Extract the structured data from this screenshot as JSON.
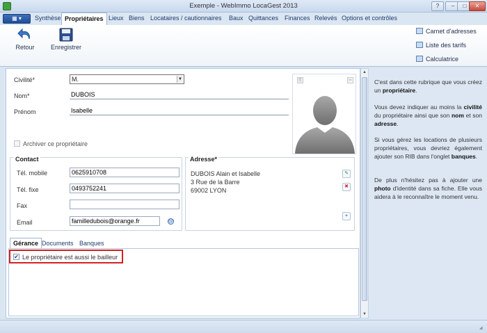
{
  "window": {
    "title": "Exemple - WebImmo LocaGest 2013",
    "help": "?",
    "minimize": "–",
    "maximize": "□",
    "close": "✕"
  },
  "file_button": "▦ ▾",
  "tabs": [
    "Synthèse",
    "Propriétaires",
    "Lieux",
    "Biens",
    "Locataires / cautionnaires",
    "Baux",
    "Quittances",
    "Finances",
    "Relevés",
    "Options et contrôles"
  ],
  "active_tab": "Propriétaires",
  "ribbon": {
    "retour": "Retour",
    "enregistrer": "Enregistrer",
    "carnet": "Carnet d'adresses",
    "tarifs": "Liste des tarifs",
    "calculatrice": "Calculatrice"
  },
  "form": {
    "civilite_label": "Civilité*",
    "civilite_value": "M.",
    "nom_label": "Nom*",
    "nom_value": "DUBOIS",
    "prenom_label": "Prénom",
    "prenom_value": "Isabelle",
    "archiver_label": "Archiver ce propriétaire",
    "contact_title": "Contact",
    "tel_mobile_label": "Tél. mobile",
    "tel_mobile_value": "0625910708",
    "tel_fixe_label": "Tél. fixe",
    "tel_fixe_value": "0493752241",
    "fax_label": "Fax",
    "fax_value": "",
    "email_label": "Email",
    "email_value": "familledubois@orange.fr",
    "adresse_title": "Adresse*",
    "adresse_lines": [
      "DUBOIS Alain et Isabelle",
      "3 Rue de la Barre",
      "69002 LYON"
    ]
  },
  "subtabs": [
    "Gérance",
    "Documents",
    "Banques"
  ],
  "active_subtab": "Gérance",
  "bailleur_label": "Le propriétaire est aussi le bailleur",
  "bailleur_checked": true,
  "help": {
    "p1_a": "C'est dans cette rubrique que vous créez un ",
    "p1_b": "propriétaire",
    "p1_c": ".",
    "p2_a": "Vous devez indiquer au moins la ",
    "p2_b": "civilité",
    "p2_c": " du propriétaire ainsi que son ",
    "p2_d": "nom",
    "p2_e": " et son ",
    "p2_f": "adresse",
    "p2_g": ".",
    "p3_a": "Si vous gérez les locations de plusieurs propriétaires, vous devriez également ajouter son RIB dans l'onglet ",
    "p3_b": "banques",
    "p3_c": ".",
    "p4_a": "De plus n'hésitez pas à ajouter une ",
    "p4_b": "photo",
    "p4_c": " d'identité dans sa fiche. Elle vous aidera à le reconnaître le moment venu."
  },
  "colors": {
    "accent": "#1f4f99",
    "highlight": "#d42020",
    "panel": "#dde7f3"
  }
}
